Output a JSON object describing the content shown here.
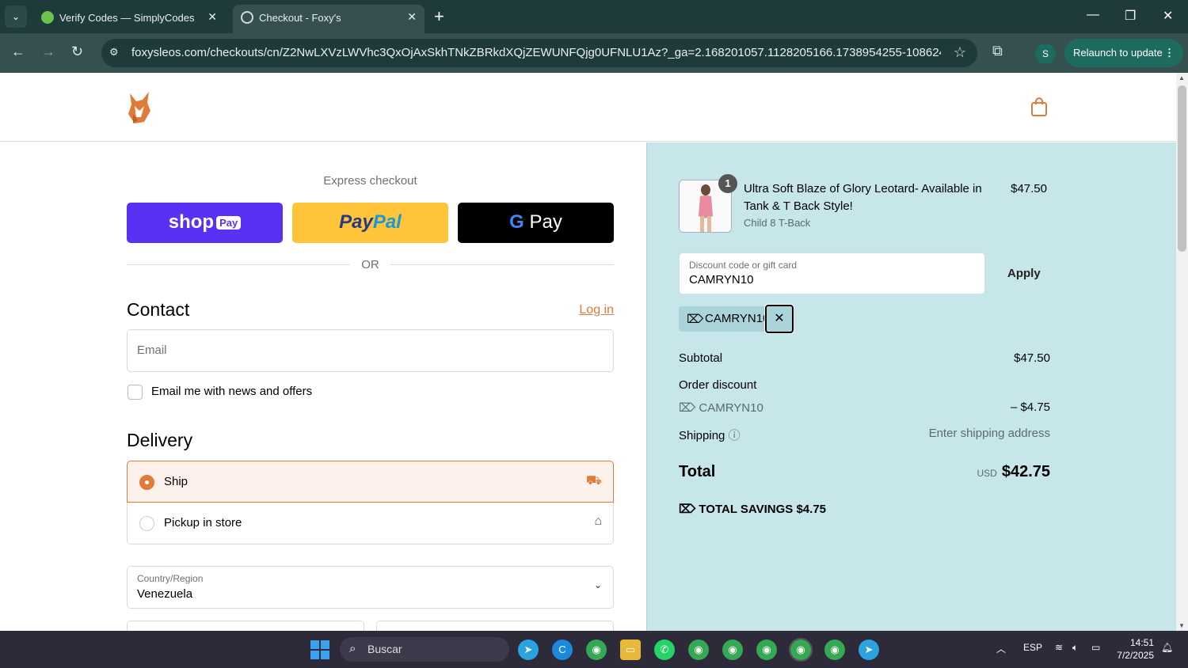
{
  "browser": {
    "tabs": [
      {
        "title": "Verify Codes — SimplyCodes",
        "active": false
      },
      {
        "title": "Checkout - Foxy's",
        "active": true
      }
    ],
    "url": "foxysleos.com/checkouts/cn/Z2NwLXVzLWVhc3QxOjAxSkhTNkZBRkdXQjZEWUNFQjg0UFNLU1Az?_ga=2.168201057.1128205166.1738954255-1086241476...",
    "profile_initial": "S",
    "relaunch_label": "Relaunch to update"
  },
  "checkout": {
    "express_title": "Express checkout",
    "or_text": "OR",
    "contact_heading": "Contact",
    "login_link": "Log in",
    "email_placeholder": "Email",
    "news_checkbox_label": "Email me with news and offers",
    "delivery_heading": "Delivery",
    "delivery_options": [
      {
        "label": "Ship",
        "selected": true,
        "icon": "truck-icon"
      },
      {
        "label": "Pickup in store",
        "selected": false,
        "icon": "store-icon"
      }
    ],
    "country_label": "Country/Region",
    "country_value": "Venezuela"
  },
  "summary": {
    "product": {
      "name": "Ultra Soft Blaze of Glory Leotard- Available in Tank & T Back Style!",
      "variant": "Child 8 T-Back",
      "price": "$47.50",
      "quantity": "1"
    },
    "discount_label": "Discount code or gift card",
    "discount_value": "CAMRYN10",
    "apply_label": "Apply",
    "applied_tag": "CAMRYN10",
    "subtotal_label": "Subtotal",
    "subtotal_value": "$47.50",
    "order_discount_label": "Order discount",
    "discount_code": "CAMRYN10",
    "discount_amount": "– $4.75",
    "shipping_label": "Shipping",
    "shipping_value": "Enter shipping address",
    "total_label": "Total",
    "currency": "USD",
    "total_value": "$42.75",
    "savings_label": "TOTAL SAVINGS",
    "savings_value": "$4.75"
  },
  "taskbar": {
    "search_placeholder": "Buscar",
    "language": "ESP",
    "time": "14:51",
    "date": "7/2/2025"
  },
  "colors": {
    "accent": "#e07b39",
    "summary_bg": "#c6e6ea",
    "shop_pay": "#5a31f4",
    "paypal": "#ffc439"
  }
}
